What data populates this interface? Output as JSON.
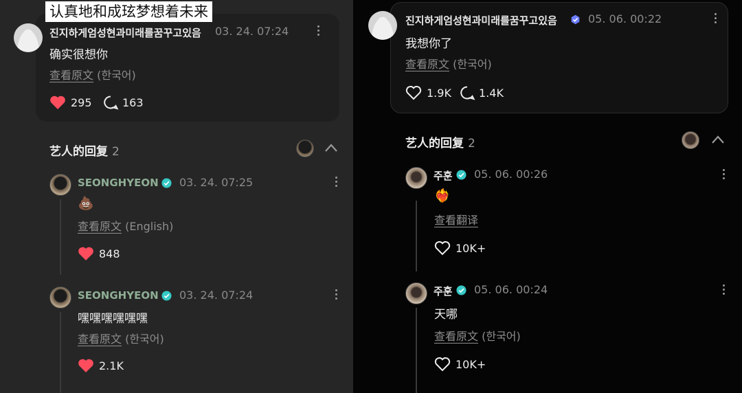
{
  "caption": "认真地和成玹梦想着未来",
  "left": {
    "post": {
      "username": "진지하게엄성현과미래를꿈꾸고있음",
      "time": "03. 24. 07:24",
      "text": "确实很想你",
      "see_original": "查看原文",
      "lang": "(한국어)",
      "likes": "295",
      "replies": "163"
    },
    "artist_section": {
      "title": "艺人的回复",
      "count": "2"
    },
    "replies": [
      {
        "username": "SEONGHYEON",
        "time": "03. 24. 07:25",
        "text": "💩",
        "see_original": "查看原文",
        "lang": "(English)",
        "likes": "848"
      },
      {
        "username": "SEONGHYEON",
        "time": "03. 24. 07:24",
        "text": "嘿嘿嘿嘿嘿嘿",
        "see_original": "查看原文",
        "lang": "(한국어)",
        "likes": "2.1K"
      }
    ]
  },
  "right": {
    "post": {
      "username": "진지하게엄성현과미래를꿈꾸고있음",
      "time": "05. 06. 00:22",
      "text": "我想你了",
      "see_original": "查看原文",
      "lang": "(한국어)",
      "likes": "1.9K",
      "replies": "1.4K"
    },
    "artist_section": {
      "title": "艺人的回复",
      "count": "2"
    },
    "replies": [
      {
        "username": "주훈",
        "time": "05. 06. 00:26",
        "text": "❤️‍🔥",
        "see_translation": "查看翻译",
        "likes": "10K+"
      },
      {
        "username": "주훈",
        "time": "05. 06. 00:24",
        "text": "天哪",
        "see_original": "查看原文",
        "lang": "(한국어)",
        "likes": "10K+"
      }
    ]
  },
  "colors": {
    "like_red": "#ff4d5e",
    "verified_teal": "#36c9c6",
    "artist_name_green": "#8fae95",
    "verified_purple": "#6b7cff"
  }
}
